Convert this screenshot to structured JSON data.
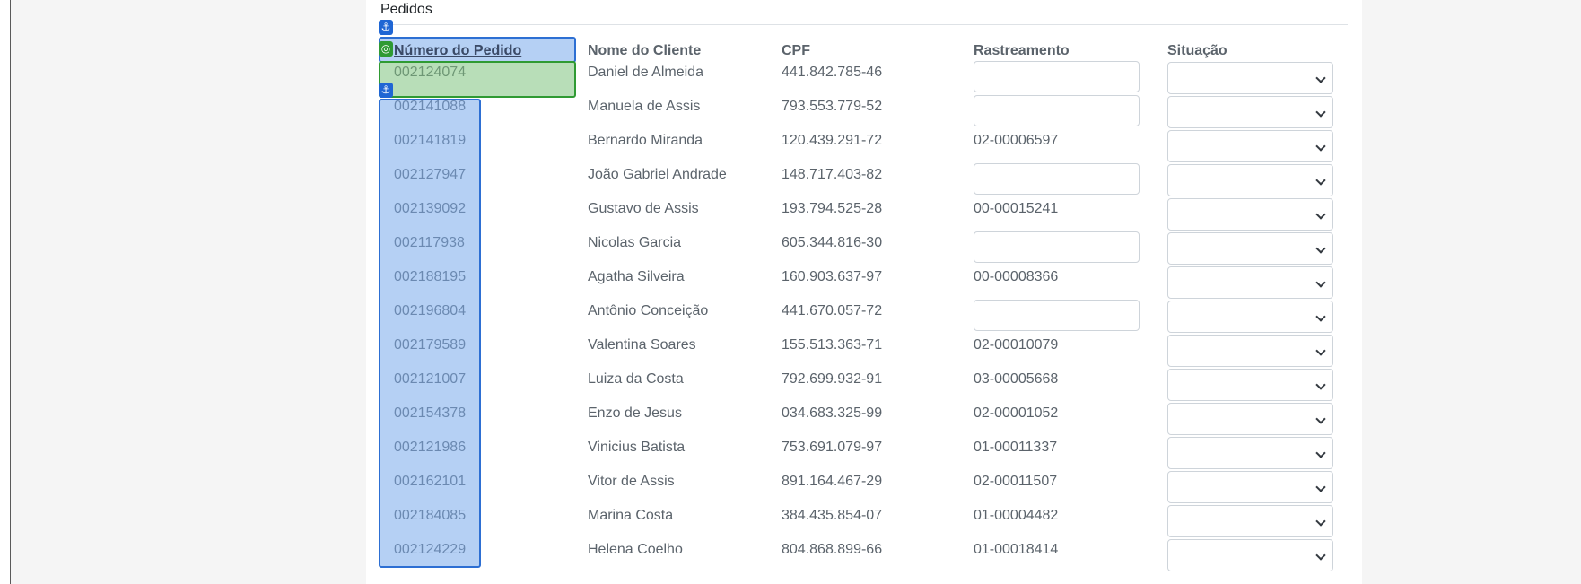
{
  "section": {
    "title": "Pedidos"
  },
  "table": {
    "headers": [
      "Número do Pedido",
      "Nome do Cliente",
      "CPF",
      "Rastreamento",
      "Situação"
    ],
    "rows": [
      {
        "order": "002124074",
        "client": "Daniel de Almeida",
        "cpf": "441.842.785-46",
        "tracking": "",
        "tracking_input": true
      },
      {
        "order": "002141088",
        "client": "Manuela de Assis",
        "cpf": "793.553.779-52",
        "tracking": "",
        "tracking_input": true
      },
      {
        "order": "002141819",
        "client": "Bernardo Miranda",
        "cpf": "120.439.291-72",
        "tracking": "02-00006597",
        "tracking_input": false
      },
      {
        "order": "002127947",
        "client": "João Gabriel Andrade",
        "cpf": "148.717.403-82",
        "tracking": "",
        "tracking_input": true
      },
      {
        "order": "002139092",
        "client": "Gustavo de Assis",
        "cpf": "193.794.525-28",
        "tracking": "00-00015241",
        "tracking_input": false
      },
      {
        "order": "002117938",
        "client": "Nicolas Garcia",
        "cpf": "605.344.816-30",
        "tracking": "",
        "tracking_input": true
      },
      {
        "order": "002188195",
        "client": "Agatha Silveira",
        "cpf": "160.903.637-97",
        "tracking": "00-00008366",
        "tracking_input": false
      },
      {
        "order": "002196804",
        "client": "Antônio Conceição",
        "cpf": "441.670.057-72",
        "tracking": "",
        "tracking_input": true
      },
      {
        "order": "002179589",
        "client": "Valentina Soares",
        "cpf": "155.513.363-71",
        "tracking": "02-00010079",
        "tracking_input": false
      },
      {
        "order": "002121007",
        "client": "Luiza da Costa",
        "cpf": "792.699.932-91",
        "tracking": "03-00005668",
        "tracking_input": false
      },
      {
        "order": "002154378",
        "client": "Enzo de Jesus",
        "cpf": "034.683.325-99",
        "tracking": "02-00001052",
        "tracking_input": false
      },
      {
        "order": "002121986",
        "client": "Vinicius Batista",
        "cpf": "753.691.079-97",
        "tracking": "01-00011337",
        "tracking_input": false
      },
      {
        "order": "002162101",
        "client": "Vitor de Assis",
        "cpf": "891.164.467-29",
        "tracking": "02-00011507",
        "tracking_input": false
      },
      {
        "order": "002184085",
        "client": "Marina Costa",
        "cpf": "384.435.854-07",
        "tracking": "01-00004482",
        "tracking_input": false
      },
      {
        "order": "002124229",
        "client": "Helena Coelho",
        "cpf": "804.868.899-66",
        "tracking": "01-00018414",
        "tracking_input": false
      }
    ]
  },
  "overlay": {
    "anchor_glyph": "⚓",
    "target_glyph": "◎",
    "colors": {
      "blue": "#2d6fd3",
      "green": "#2f9a33"
    }
  }
}
